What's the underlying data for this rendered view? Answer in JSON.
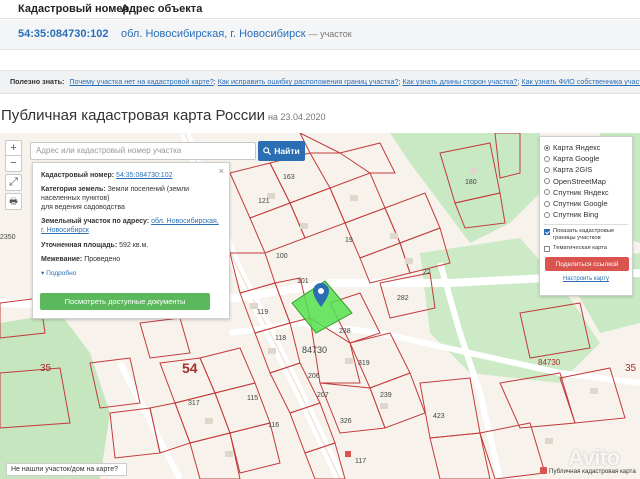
{
  "table": {
    "col_cadastral": "Кадастровый номер",
    "col_address": "Адрес объекта",
    "cadastral_number": "54:35:084730:102",
    "address": "обл. Новосибирская, г. Новосибирск",
    "address_suffix": "— участок"
  },
  "useful": {
    "label": "Полезно знать:",
    "links": [
      "Почему участка нет на кадастровой карте?",
      "Как исправить ошибку расположения границ участка?",
      "Как узнать длины сторон участка?",
      "Как узнать ФИО собственника участка?"
    ]
  },
  "title": {
    "text": "Публичная кадастровая карта России",
    "date": "на 23.04.2020"
  },
  "search": {
    "placeholder": "Адрес или кадастровый номер участка",
    "button": "Найти"
  },
  "tools": {
    "zoom_in": "+",
    "zoom_out": "−",
    "fullscreen": "⤢",
    "print": "🖶"
  },
  "info": {
    "cadastral_label": "Кадастровый номер:",
    "cadastral_value": "54:35:084730:102",
    "category_label": "Категория земель:",
    "category_value": "Земли поселений (земли населенных пунктов)",
    "category_value2": "для ведения садоводства",
    "address_label": "Земельный участок по адресу:",
    "address_value": "обл. Новосибирская, г. Новосибирск",
    "area_label": "Уточненная площадь:",
    "area_value": "592 кв.м.",
    "survey_label": "Межевание:",
    "survey_value": "Проведено",
    "more": "Подробно",
    "docs_button": "Посмотреть доступные документы",
    "close": "×"
  },
  "layers": {
    "options": [
      {
        "label": "Карта Яндекс",
        "selected": true
      },
      {
        "label": "Карта Google",
        "selected": false
      },
      {
        "label": "Карта 2GIS",
        "selected": false
      },
      {
        "label": "OpenStreetMap",
        "selected": false
      },
      {
        "label": "Спутник Яндекс",
        "selected": false
      },
      {
        "label": "Спутник Google",
        "selected": false
      },
      {
        "label": "Спутник Bing",
        "selected": false
      }
    ],
    "show_borders": "Показать кадастровые границы участков",
    "thematic": "Тематическая карта",
    "share": "Поделиться ссылкой",
    "setup": "Настроить карту"
  },
  "map": {
    "labels": [
      "163",
      "180",
      "121",
      "100",
      "101",
      "19",
      "119",
      "118",
      "84730",
      "238",
      "206",
      "207",
      "319",
      "239",
      "54",
      "317",
      "115",
      "116",
      "282",
      "22",
      "2350",
      "35",
      "35",
      "84730",
      "423",
      "326",
      "117"
    ],
    "not_found": "Не нашли участок/дом на карте?",
    "credit": "Публичная кадастровая карта",
    "watermark": "Avito"
  },
  "colors": {
    "link": "#2a6fb8",
    "find_button": "#2b6eb3",
    "docs_button": "#5cb85c",
    "share_button": "#d9534f",
    "parcel_border": "#c23b3b",
    "selected_parcel": "#55e04f",
    "forest": "#c8e9c3"
  }
}
